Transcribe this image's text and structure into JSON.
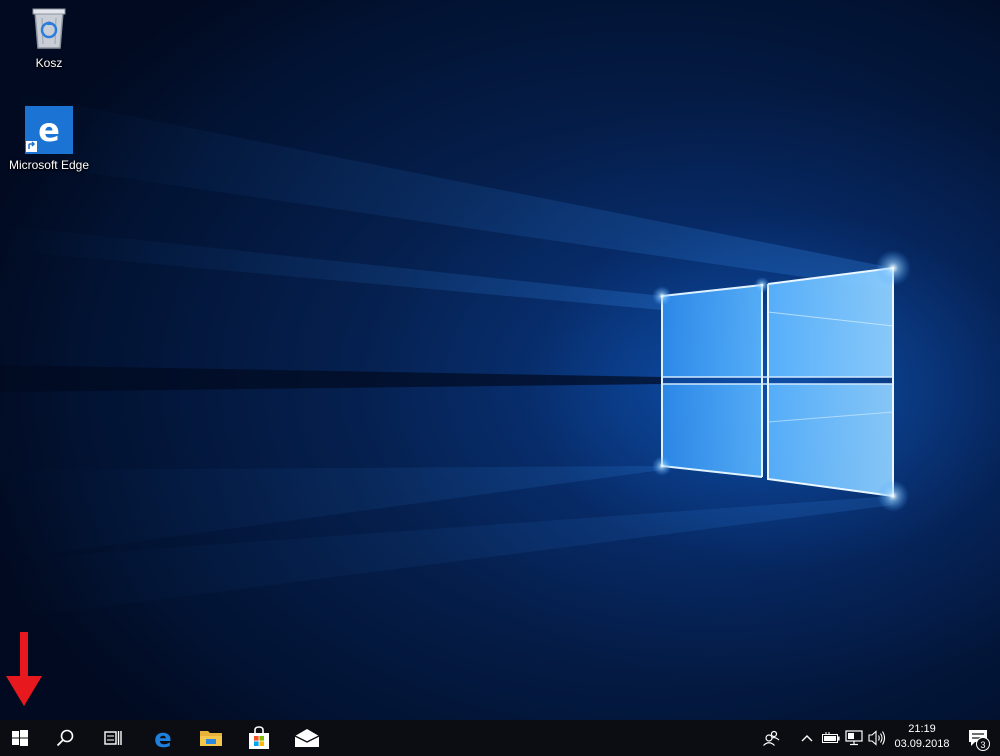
{
  "desktop": {
    "icons": [
      {
        "label": "Kosz",
        "icon": "recycle-bin-icon"
      },
      {
        "label": "Microsoft Edge",
        "icon": "edge-icon"
      }
    ]
  },
  "taskbar": {
    "start": {
      "icon": "windows-logo-icon"
    },
    "search": {
      "icon": "search-icon"
    },
    "task_view": {
      "icon": "task-view-icon"
    },
    "pinned": [
      {
        "name": "Microsoft Edge",
        "icon": "edge-icon",
        "color": "#1e7fdc"
      },
      {
        "name": "File Explorer",
        "icon": "folder-icon",
        "color": "#f4c64a"
      },
      {
        "name": "Microsoft Store",
        "icon": "store-bag-icon",
        "color": "#ffffff"
      },
      {
        "name": "Mail",
        "icon": "mail-icon",
        "color": "#ffffff"
      }
    ],
    "tray": {
      "icons": [
        "people-icon",
        "chevron-up-icon",
        "battery-icon",
        "network-icon",
        "volume-icon"
      ],
      "time": "21:19",
      "date": "03.09.2018",
      "notification_count": "3"
    }
  },
  "colors": {
    "accent": "#1e7fdc",
    "taskbar": "#0b0d12",
    "arrow": "#e8191e"
  }
}
